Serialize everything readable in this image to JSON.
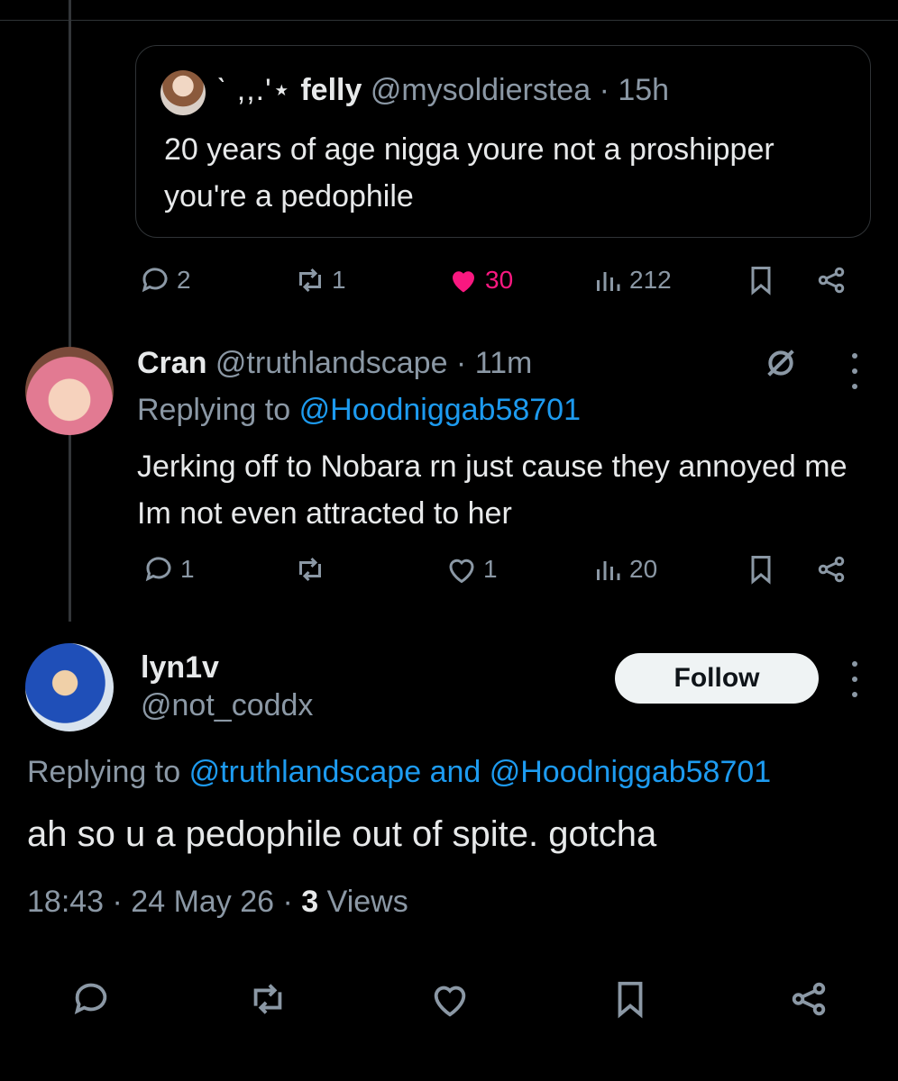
{
  "quoted": {
    "deco": "ˋ ,,.'⋆",
    "name": "felly",
    "handle": "@mysoldierstea",
    "time": "· 15h",
    "text": "20 years of age nigga youre not a proshipper you're a pedophile",
    "stats": {
      "replies": "2",
      "reposts": "1",
      "likes": "30",
      "views": "212"
    }
  },
  "reply": {
    "name": "Cran",
    "handle": "@truthlandscape · 11m",
    "replying_prefix": "Replying to",
    "replying_to": "@Hoodniggab58701",
    "text": "Jerking off to Nobara rn just cause they annoyed me Im not even attracted to her",
    "stats": {
      "replies": "1",
      "reposts": "",
      "likes": "1",
      "views": "20"
    }
  },
  "main": {
    "name": "lyn1v",
    "handle": "@not_coddx",
    "follow_label": "Follow",
    "replying_prefix": "Replying to",
    "replying_to": "@truthlandscape and @Hoodniggab58701",
    "text": "ah so u a pedophile out of spite. gotcha",
    "time": "18:43 · 24 May 26 ·",
    "views_count": "3",
    "views_label": "Views"
  },
  "colors": {
    "background": "#000000",
    "text": "#e7e9ea",
    "muted": "#8b98a5",
    "link": "#1d9bf0",
    "like": "#f91880"
  }
}
